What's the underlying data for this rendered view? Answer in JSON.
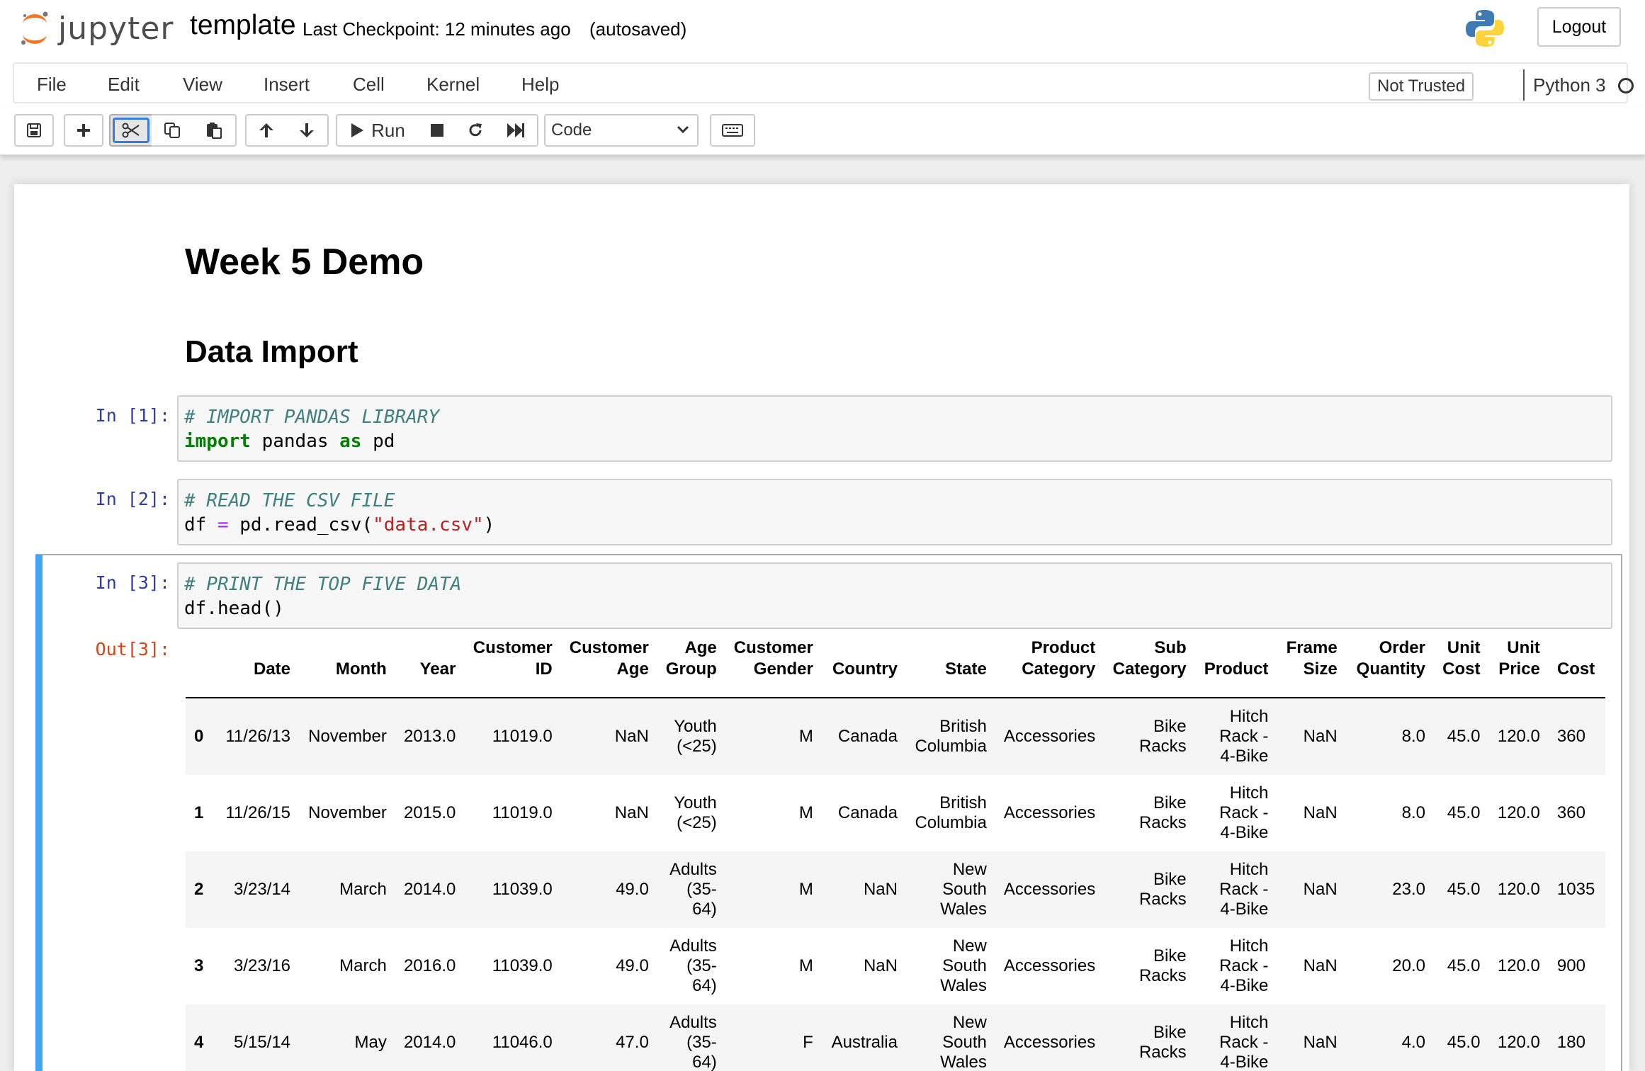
{
  "header": {
    "logo_text": "jupyter",
    "notebook_name": "template",
    "checkpoint": "Last Checkpoint: 12 minutes ago",
    "autosave": "(autosaved)",
    "logout_label": "Logout"
  },
  "menubar": {
    "items": [
      "File",
      "Edit",
      "View",
      "Insert",
      "Cell",
      "Kernel",
      "Help"
    ],
    "trust_label": "Not Trusted",
    "kernel_name": "Python 3"
  },
  "toolbar": {
    "run_label": "Run",
    "cell_type": "Code"
  },
  "notebook": {
    "h1": "Week 5 Demo",
    "h2": "Data Import",
    "cells": [
      {
        "prompt": "In [1]:",
        "comment": "# IMPORT PANDAS LIBRARY",
        "kw1": "import",
        "mid": " pandas ",
        "kw2": "as",
        "end": " pd"
      },
      {
        "prompt": "In [2]:",
        "comment": "# READ THE CSV FILE",
        "pre": "df ",
        "op": "=",
        "call": " pd.read_csv(",
        "str": "\"data.csv\"",
        "close": ")"
      },
      {
        "prompt": "In [3]:",
        "comment": "# PRINT THE TOP FIVE DATA",
        "code": "df.head()",
        "out_prompt": "Out[3]:"
      }
    ]
  },
  "dataframe": {
    "columns": [
      "",
      "Date",
      "Month",
      "Year",
      "Customer ID",
      "Customer Age",
      "Age Group",
      "Customer Gender",
      "Country",
      "State",
      "Product Category",
      "Sub Category",
      "Product",
      "Frame Size",
      "Order Quantity",
      "Unit Cost",
      "Unit Price",
      "Cost"
    ],
    "rows": [
      [
        "0",
        "11/26/13",
        "November",
        "2013.0",
        "11019.0",
        "NaN",
        "Youth (<25)",
        "M",
        "Canada",
        "British Columbia",
        "Accessories",
        "Bike Racks",
        "Hitch Rack - 4-Bike",
        "NaN",
        "8.0",
        "45.0",
        "120.0",
        "360"
      ],
      [
        "1",
        "11/26/15",
        "November",
        "2015.0",
        "11019.0",
        "NaN",
        "Youth (<25)",
        "M",
        "Canada",
        "British Columbia",
        "Accessories",
        "Bike Racks",
        "Hitch Rack - 4-Bike",
        "NaN",
        "8.0",
        "45.0",
        "120.0",
        "360"
      ],
      [
        "2",
        "3/23/14",
        "March",
        "2014.0",
        "11039.0",
        "49.0",
        "Adults (35-64)",
        "M",
        "NaN",
        "New South Wales",
        "Accessories",
        "Bike Racks",
        "Hitch Rack - 4-Bike",
        "NaN",
        "23.0",
        "45.0",
        "120.0",
        "1035"
      ],
      [
        "3",
        "3/23/16",
        "March",
        "2016.0",
        "11039.0",
        "49.0",
        "Adults (35-64)",
        "M",
        "NaN",
        "New South Wales",
        "Accessories",
        "Bike Racks",
        "Hitch Rack - 4-Bike",
        "NaN",
        "20.0",
        "45.0",
        "120.0",
        "900"
      ],
      [
        "4",
        "5/15/14",
        "May",
        "2014.0",
        "11046.0",
        "47.0",
        "Adults (35-64)",
        "F",
        "Australia",
        "New South Wales",
        "Accessories",
        "Bike Racks",
        "Hitch Rack - 4-Bike",
        "NaN",
        "4.0",
        "45.0",
        "120.0",
        "180"
      ]
    ]
  }
}
